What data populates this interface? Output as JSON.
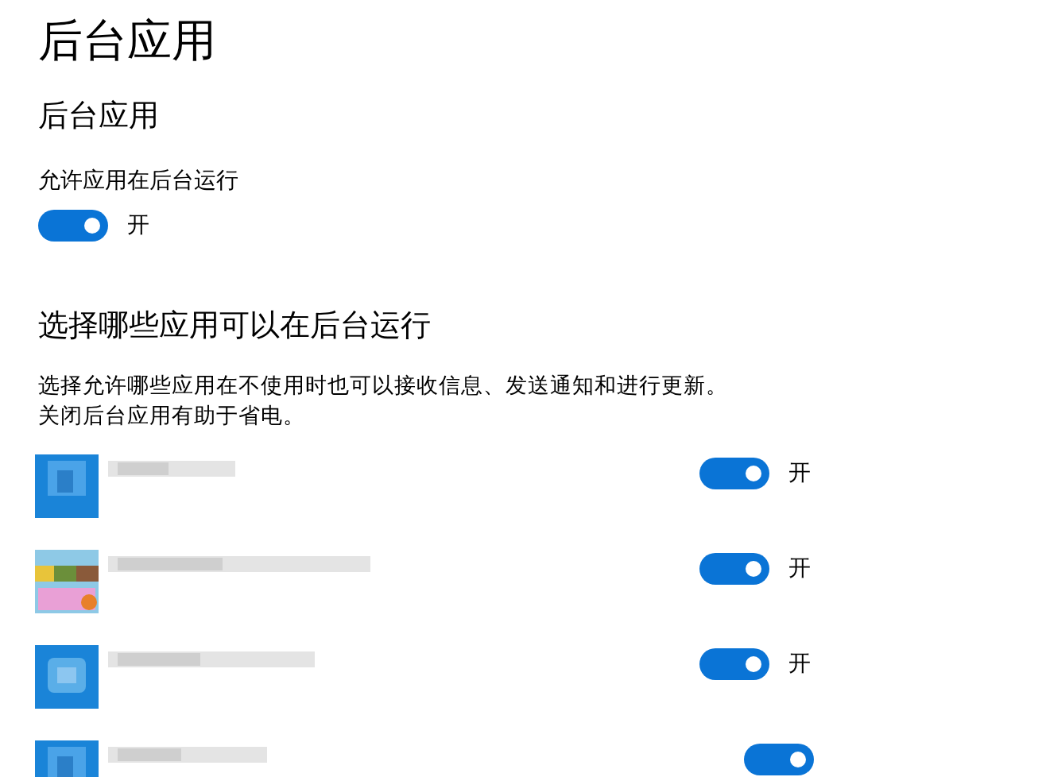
{
  "page_title": "后台应用",
  "section": {
    "title": "后台应用",
    "toggle_label": "允许应用在后台运行",
    "toggle": {
      "on": true,
      "state_text": "开"
    }
  },
  "apps_section": {
    "title": "选择哪些应用可以在后台运行",
    "description": "选择允许哪些应用在不使用时也可以接收信息、发送通知和进行更新。关闭后台应用有助于省电。",
    "apps": [
      {
        "kind": "blue",
        "on": true,
        "state_text": "开"
      },
      {
        "kind": "candy",
        "on": true,
        "state_text": "开"
      },
      {
        "kind": "camera",
        "on": true,
        "state_text": "开"
      },
      {
        "kind": "blue",
        "on": true
      }
    ]
  }
}
